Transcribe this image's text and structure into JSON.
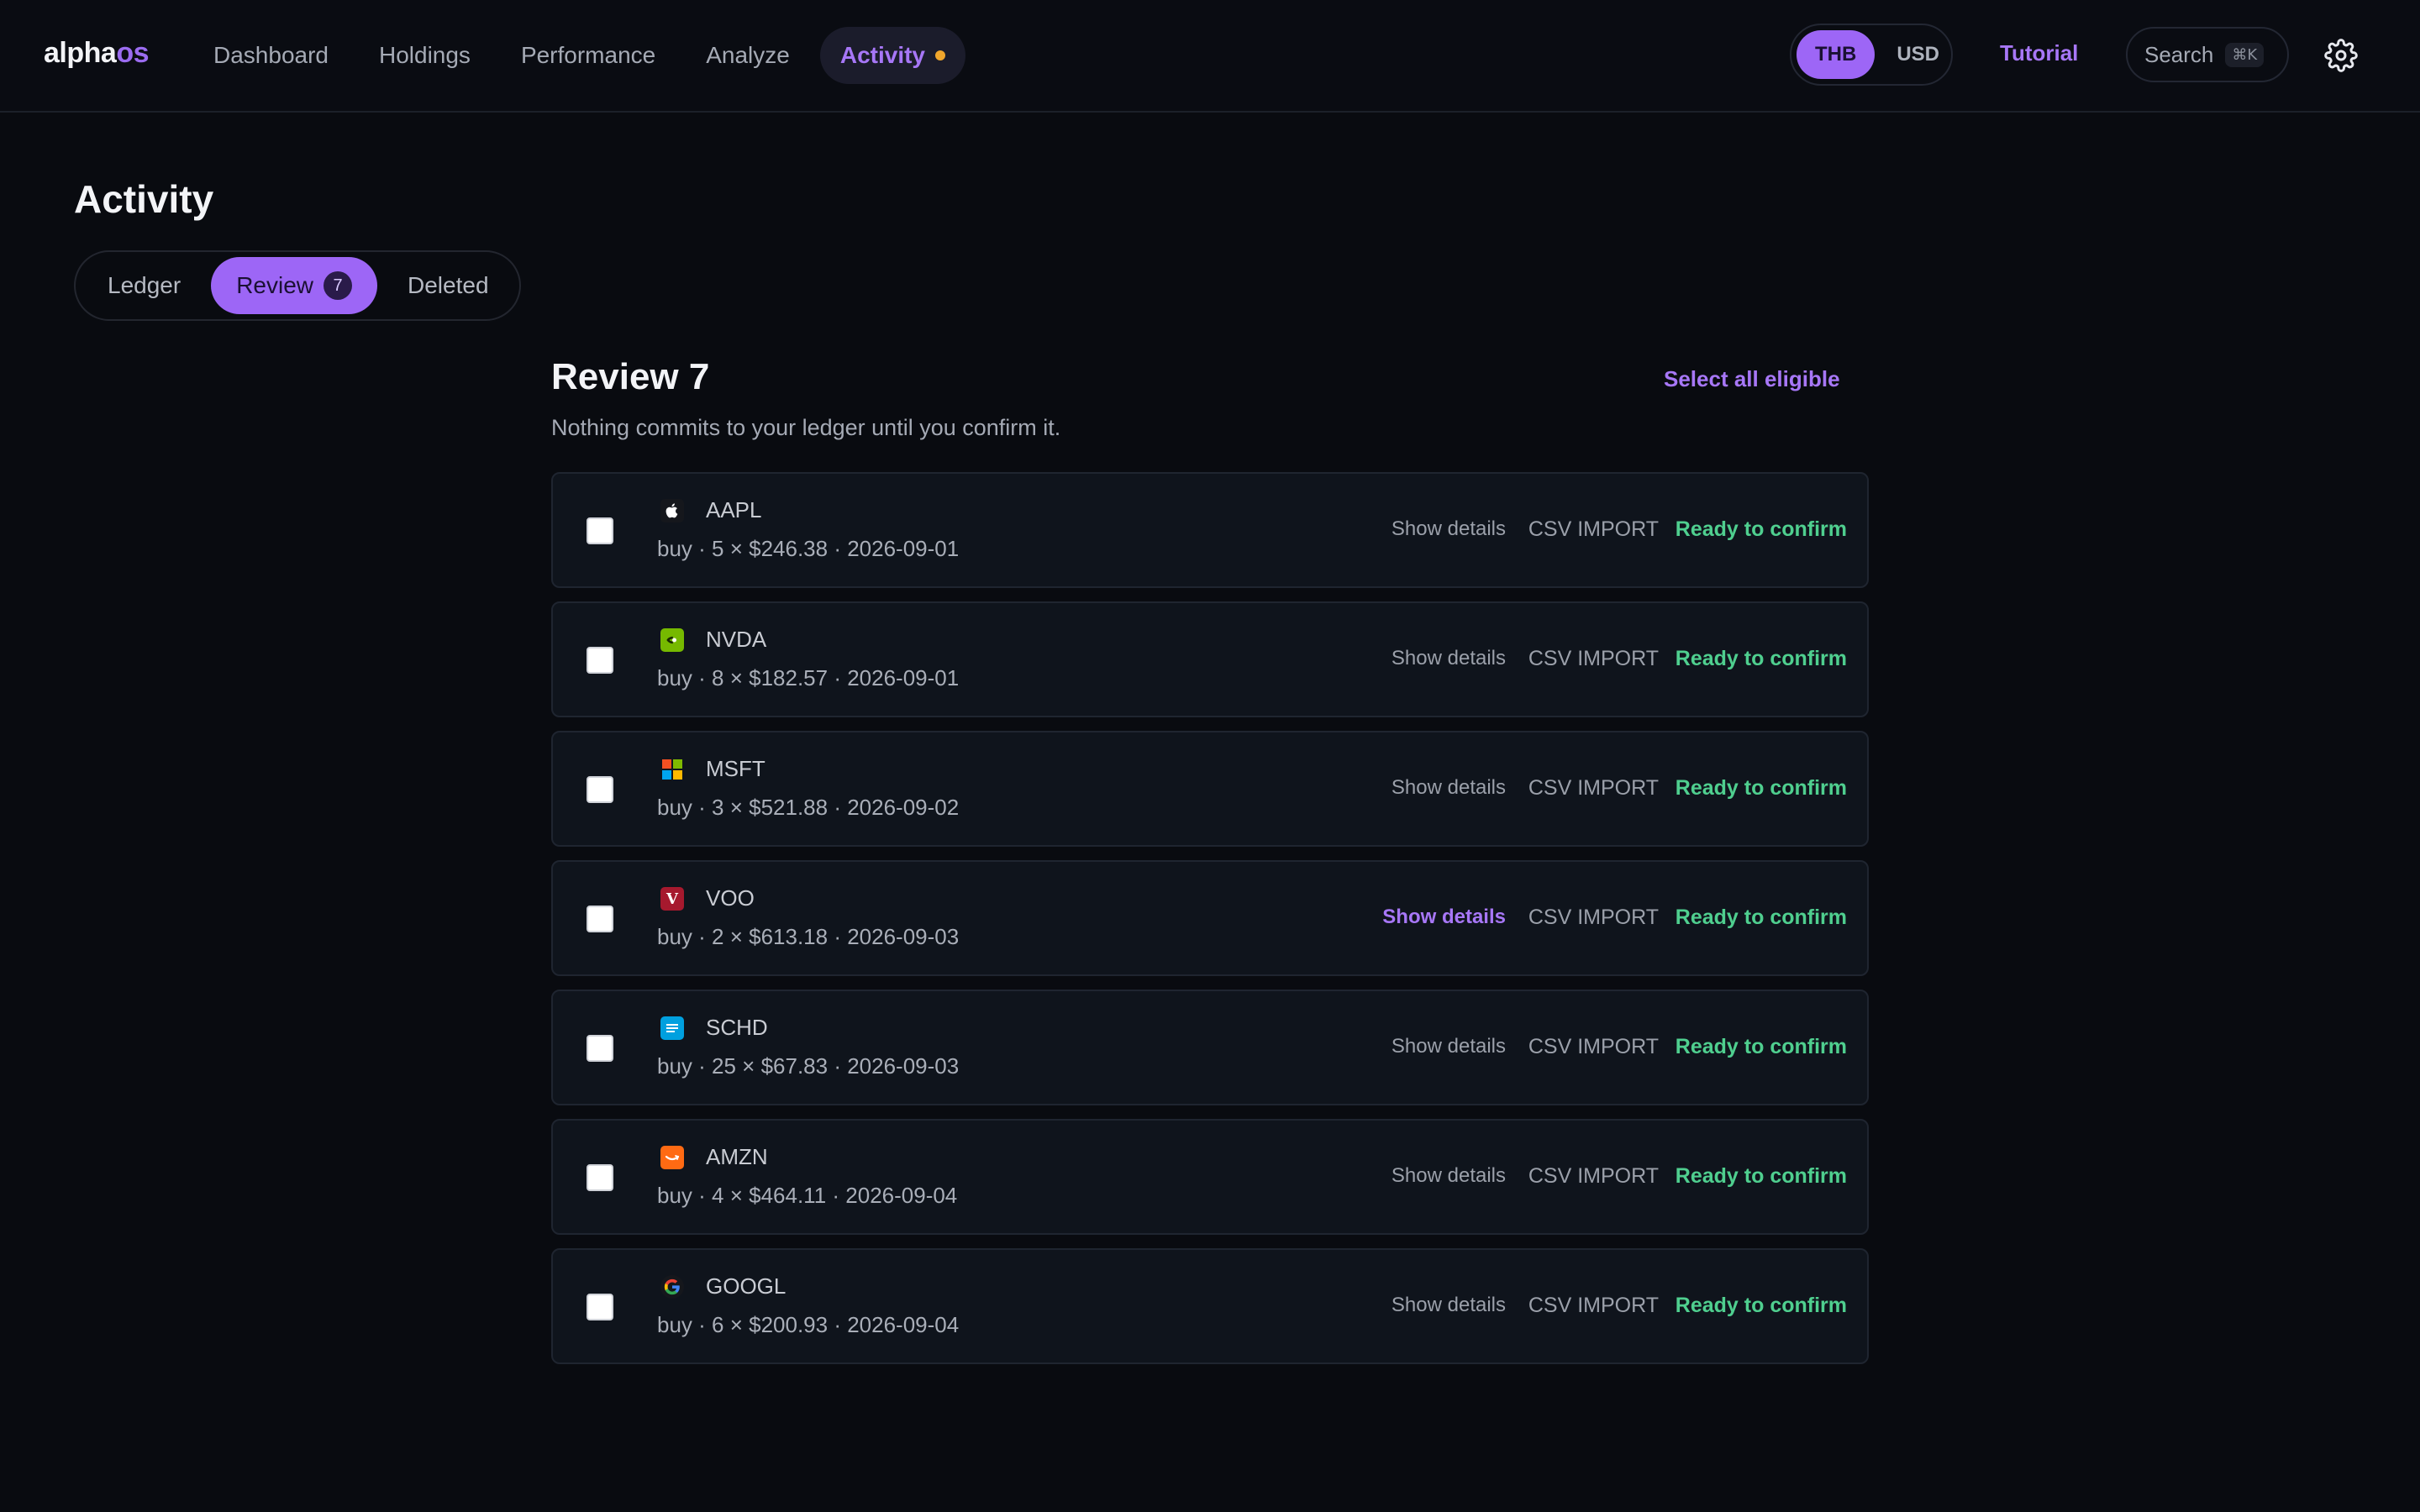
{
  "logo": {
    "part1": "alpha",
    "part2": "os"
  },
  "nav": [
    "Dashboard",
    "Holdings",
    "Performance",
    "Analyze",
    "Activity"
  ],
  "currency": [
    "THB",
    "USD"
  ],
  "tutorial": "Tutorial",
  "search": {
    "label": "Search",
    "shortcut": "⌘K"
  },
  "page_title": "Activity",
  "tabs": {
    "ledger": "Ledger",
    "review": "Review",
    "review_count": "7",
    "deleted": "Deleted"
  },
  "review": {
    "title": "Review 7",
    "select_all": "Select all eligible",
    "subtitle": "Nothing commits to your ledger until you confirm it."
  },
  "row_labels": {
    "show_details": "Show details",
    "source": "CSV IMPORT",
    "status": "Ready to confirm"
  },
  "items": [
    {
      "ticker": "AAPL",
      "details": "buy · 5 × $246.38 · 2026-09-01",
      "icon": "apple-icon"
    },
    {
      "ticker": "NVDA",
      "details": "buy · 8 × $182.57 · 2026-09-01",
      "icon": "nvidia-icon"
    },
    {
      "ticker": "MSFT",
      "details": "buy · 3 × $521.88 · 2026-09-02",
      "icon": "microsoft-icon"
    },
    {
      "ticker": "VOO",
      "details": "buy · 2 × $613.18 · 2026-09-03",
      "icon": "vanguard-icon"
    },
    {
      "ticker": "SCHD",
      "details": "buy · 25 × $67.83 · 2026-09-03",
      "icon": "schwab-icon"
    },
    {
      "ticker": "AMZN",
      "details": "buy · 4 × $464.11 · 2026-09-04",
      "icon": "amazon-icon"
    },
    {
      "ticker": "GOOGL",
      "details": "buy · 6 × $200.93 · 2026-09-04",
      "icon": "google-icon"
    }
  ],
  "colors": {
    "accent": "#9d66f6",
    "status_green": "#4fcf8f",
    "notification_dot": "#f0a62c"
  }
}
